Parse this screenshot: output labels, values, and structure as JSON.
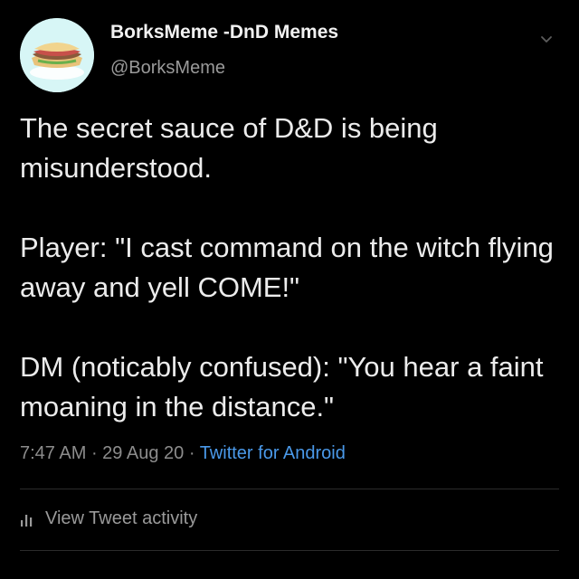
{
  "tweet": {
    "author": {
      "display_name": "BorksMeme -DnD Memes",
      "handle": "@BorksMeme",
      "avatar_icon": "sandwich-icon"
    },
    "menu_icon": "chevron-down-icon",
    "paragraphs": [
      "The secret sauce of D&D is being misunderstood.",
      "Player: \"I cast command on the witch flying away and yell COME!\"",
      "DM (noticably confused): \"You hear a faint moaning in the distance.\""
    ],
    "meta": {
      "time": "7:47 AM",
      "separator": " · ",
      "date": "29 Aug 20",
      "source": "Twitter for Android"
    },
    "activity": {
      "icon": "analytics-bars-icon",
      "label": "View Tweet activity"
    }
  },
  "colors": {
    "background": "#000000",
    "text": "#ececec",
    "muted": "#9a9a9a",
    "link": "#4a99e9",
    "avatar_bg": "#d7f6f6"
  }
}
